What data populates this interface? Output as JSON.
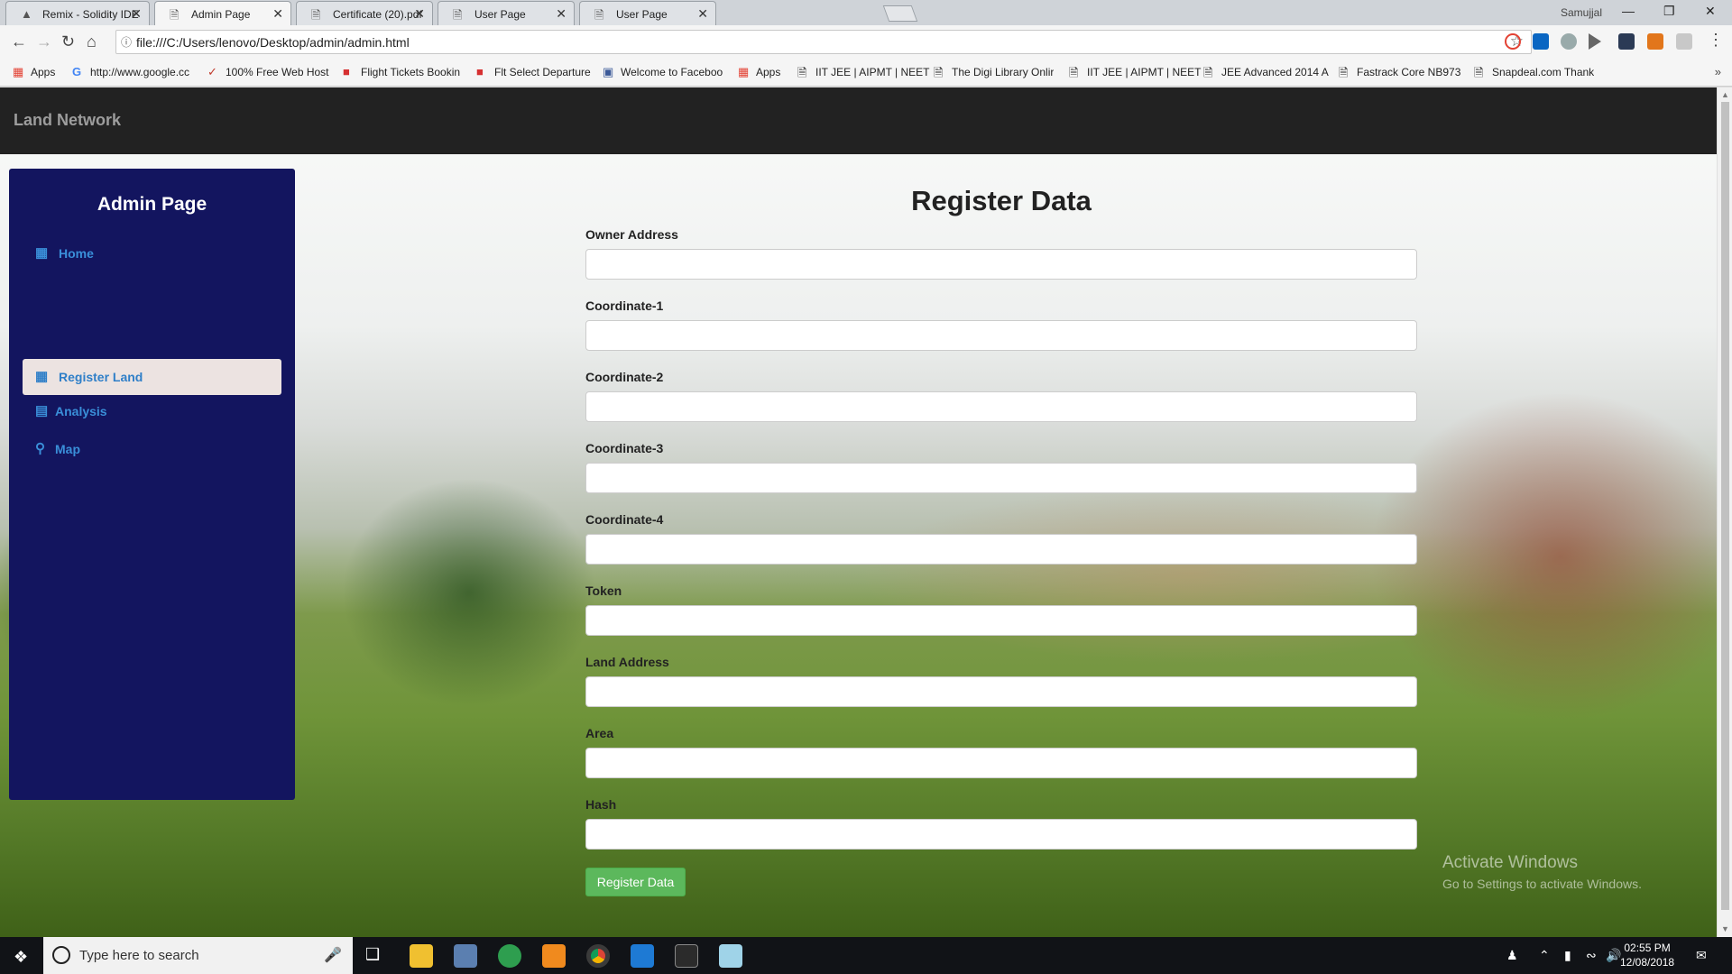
{
  "browser": {
    "tabs": [
      {
        "title": "Remix - Solidity IDE",
        "icon": "remix-icon",
        "active": false
      },
      {
        "title": "Admin Page",
        "icon": "page-icon",
        "active": true
      },
      {
        "title": "Certificate (20).pdf",
        "icon": "page-icon",
        "active": false
      },
      {
        "title": "User Page",
        "icon": "page-icon",
        "active": false
      },
      {
        "title": "User Page",
        "icon": "page-icon",
        "active": false
      }
    ],
    "profile_name": "Samujjal",
    "url": "file:///C:/Users/lenovo/Desktop/admin/admin.html",
    "bookmarks": [
      {
        "label": "Apps",
        "icon": "apps-grid-icon"
      },
      {
        "label": "http://www.google.cc",
        "icon": "google-icon"
      },
      {
        "label": "100% Free Web Host",
        "icon": "bookmark-icon"
      },
      {
        "label": "Flight Tickets Bookin",
        "icon": "bookmark-icon"
      },
      {
        "label": "Flt Select Departure",
        "icon": "bookmark-icon"
      },
      {
        "label": "Welcome to Faceboo",
        "icon": "facebook-icon"
      },
      {
        "label": "Apps",
        "icon": "apps-grid-icon"
      },
      {
        "label": "IIT JEE | AIPMT | NEET",
        "icon": "page-icon"
      },
      {
        "label": "The Digi Library Onlir",
        "icon": "page-icon"
      },
      {
        "label": "IIT JEE | AIPMT | NEET",
        "icon": "page-icon"
      },
      {
        "label": "JEE Advanced 2014 A",
        "icon": "page-icon"
      },
      {
        "label": "Fastrack Core NB973",
        "icon": "page-icon"
      },
      {
        "label": "Snapdeal.com Thank",
        "icon": "page-icon"
      }
    ]
  },
  "page": {
    "brand": "Land Network",
    "sidebar": {
      "title": "Admin Page",
      "items": [
        {
          "label": "Home",
          "icon": "grid-icon",
          "active": false
        },
        {
          "label": "Register Land",
          "icon": "grid-icon",
          "active": true
        },
        {
          "label": "Analysis",
          "icon": "list-icon",
          "active": false
        },
        {
          "label": "Map",
          "icon": "map-marker-icon",
          "active": false
        }
      ]
    },
    "form": {
      "title": "Register Data",
      "fields": [
        {
          "label": "Owner Address",
          "value": ""
        },
        {
          "label": "Coordinate-1",
          "value": ""
        },
        {
          "label": "Coordinate-2",
          "value": ""
        },
        {
          "label": "Coordinate-3",
          "value": ""
        },
        {
          "label": "Coordinate-4",
          "value": ""
        },
        {
          "label": "Token",
          "value": ""
        },
        {
          "label": "Land Address",
          "value": ""
        },
        {
          "label": "Area",
          "value": ""
        },
        {
          "label": "Hash",
          "value": ""
        }
      ],
      "submit_label": "Register Data",
      "submit_color": "#5cb85c"
    },
    "watermark": {
      "line1": "Activate Windows",
      "line2": "Go to Settings to activate Windows."
    },
    "colors": {
      "navbar": "#222222",
      "sidebar": "#13155f",
      "sidebar_link": "#3a8fd9",
      "active_item_bg": "#ece3e1"
    }
  },
  "taskbar": {
    "search_placeholder": "Type here to search",
    "time": "02:55 PM",
    "date": "12/08/2018"
  }
}
